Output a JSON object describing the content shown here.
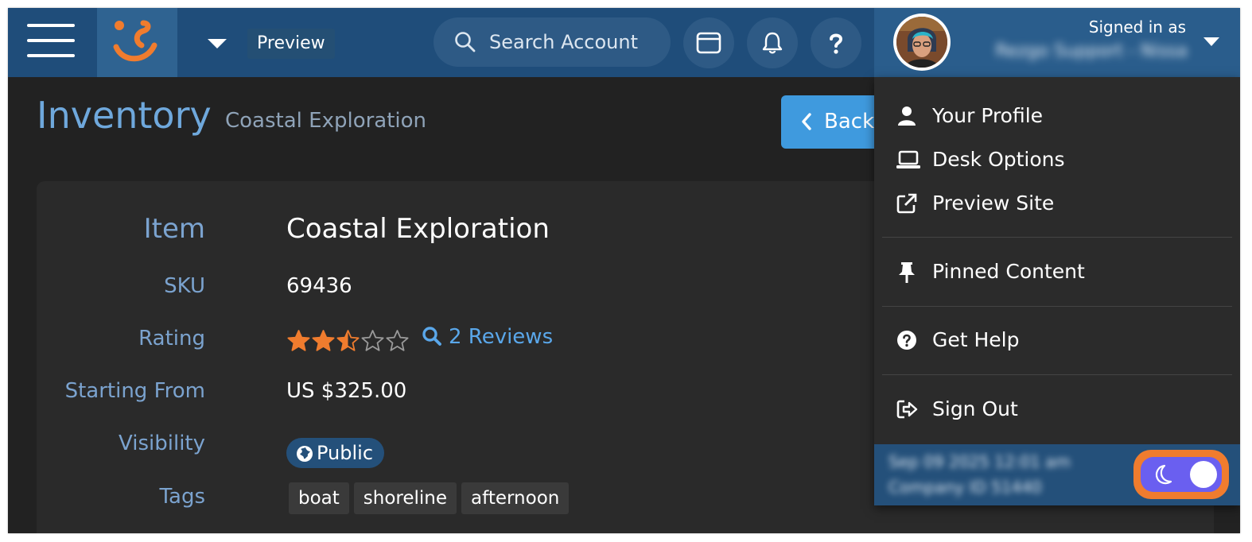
{
  "topbar": {
    "preview_label": "Preview",
    "search_placeholder": "Search Account",
    "signed_in_label": "Signed in as",
    "signed_in_name": "Rezgo Support - Nissa"
  },
  "page": {
    "title": "Inventory",
    "subtitle": "Coastal Exploration",
    "back_label": "Back"
  },
  "item": {
    "labels": {
      "item": "Item",
      "sku": "SKU",
      "rating": "Rating",
      "starting_from": "Starting From",
      "visibility": "Visibility",
      "tags": "Tags"
    },
    "name": "Coastal Exploration",
    "sku": "69436",
    "rating": 2.5,
    "rating_max": 5,
    "reviews_label": "2 Reviews",
    "price": "US $325.00",
    "visibility": "Public",
    "tags": [
      "boat",
      "shoreline",
      "afternoon"
    ]
  },
  "menu": {
    "items": [
      {
        "label": "Your Profile",
        "icon": "user-icon"
      },
      {
        "label": "Desk Options",
        "icon": "laptop-icon"
      },
      {
        "label": "Preview Site",
        "icon": "external-link-icon"
      },
      {
        "label": "Pinned Content",
        "icon": "pin-icon"
      },
      {
        "label": "Get Help",
        "icon": "question-circle-icon"
      },
      {
        "label": "Sign Out",
        "icon": "sign-out-icon"
      }
    ],
    "footer_time": "Sep 09 2025 12:01 am",
    "footer_company": "Company ID 51440"
  },
  "colors": {
    "topbar": "#1f4d7a",
    "accent_blue": "#3f9ade",
    "star_orange": "#f07c2e",
    "toggle": "#6a5ff0"
  }
}
